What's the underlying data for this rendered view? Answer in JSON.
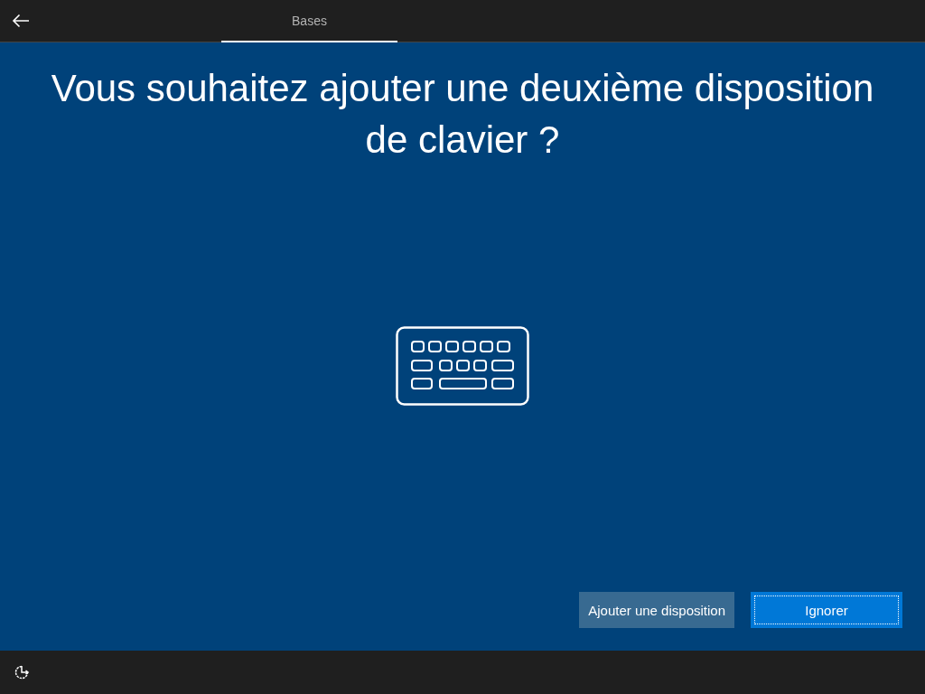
{
  "header": {
    "tabs": [
      {
        "label": "Bases",
        "selected": true
      }
    ]
  },
  "title": "Vous souhaitez ajouter une deuxième disposition de clavier ?",
  "buttons": [
    {
      "label": "Ajouter une disposition",
      "kind": "secondary",
      "focused": false
    },
    {
      "label": "Ignorer",
      "kind": "primary",
      "focused": true
    }
  ]
}
